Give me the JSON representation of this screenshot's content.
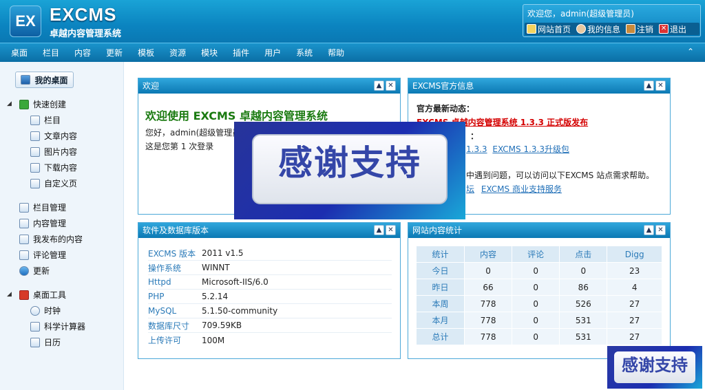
{
  "header": {
    "logo_mark": "EX",
    "logo_text": "EXCMS",
    "logo_subtitle": "卓越内容管理系统",
    "welcome": "欢迎您，admin(超级管理员)",
    "links": [
      {
        "label": "网站首页",
        "icon": "home-icon"
      },
      {
        "label": "我的信息",
        "icon": "user-icon"
      },
      {
        "label": "注销",
        "icon": "logout-icon"
      },
      {
        "label": "退出",
        "icon": "close-icon"
      }
    ]
  },
  "menu": [
    "桌面",
    "栏目",
    "内容",
    "更新",
    "模板",
    "资源",
    "模块",
    "插件",
    "用户",
    "系统",
    "帮助"
  ],
  "menu_collapse": "⌃",
  "sidebar": {
    "desk_button": "我的桌面",
    "quick_create": "快速创建",
    "quick_items": [
      "栏目",
      "文章内容",
      "图片内容",
      "下载内容",
      "自定义页"
    ],
    "manage_items": [
      "栏目管理",
      "内容管理",
      "我发布的内容",
      "评论管理",
      "更新"
    ],
    "tools": "桌面工具",
    "tool_items": [
      "时钟",
      "科学计算器",
      "日历"
    ]
  },
  "welcome_panel": {
    "title": "欢迎",
    "heading": "欢迎使用  EXCMS 卓越内容管理系统",
    "line1": "您好，admin(超级管理员",
    "line2": "这是您第  1 次登录"
  },
  "official_panel": {
    "title": "EXCMS官方信息",
    "latest_label": "官方最新动态：",
    "news": "EXCMS 卓越内容管理系统  1.3.3 正式版发布",
    "download_label": "：",
    "download_links": [
      "1.3.3",
      "EXCMS 1.3.3升级包"
    ],
    "help_text": "中遇到问题，可以访问以下EXCMS 站点需求帮助。",
    "help_links": [
      "坛",
      "EXCMS 商业支持服务"
    ]
  },
  "software_panel": {
    "title": "软件及数据库版本",
    "rows": [
      {
        "key": "EXCMS 版本",
        "value": "2011 v1.5"
      },
      {
        "key": "操作系统",
        "value": "WINNT"
      },
      {
        "key": "Httpd",
        "value": "Microsoft-IIS/6.0"
      },
      {
        "key": "PHP",
        "value": "5.2.14"
      },
      {
        "key": "MySQL",
        "value": "5.1.50-community"
      },
      {
        "key": "数据库尺寸",
        "value": "709.59KB"
      },
      {
        "key": "上传许可",
        "value": "100M"
      }
    ]
  },
  "stats_panel": {
    "title": "网站内容统计",
    "headers": [
      "统计",
      "内容",
      "评论",
      "点击",
      "Digg"
    ],
    "rows": [
      [
        "今日",
        "0",
        "0",
        "0",
        "23"
      ],
      [
        "昨日",
        "66",
        "0",
        "86",
        "4"
      ],
      [
        "本周",
        "778",
        "0",
        "526",
        "27"
      ],
      [
        "本月",
        "778",
        "0",
        "531",
        "27"
      ],
      [
        "总计",
        "778",
        "0",
        "531",
        "27"
      ]
    ]
  },
  "watermark": "感谢支持",
  "colors": {
    "accent": "#0b84c0",
    "panel_border": "#4ba8d8",
    "news_red": "#d40000",
    "heading_green": "#1a7a10"
  }
}
